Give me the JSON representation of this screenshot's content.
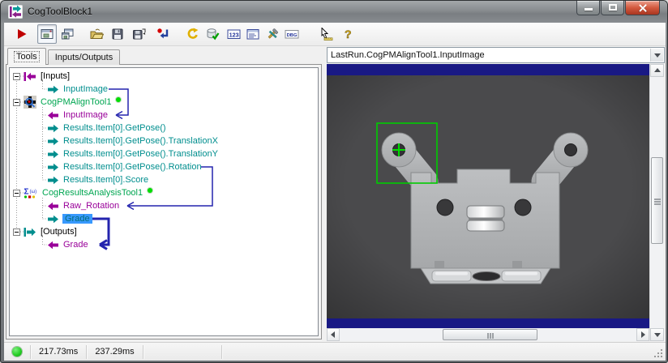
{
  "window": {
    "title": "CogToolBlock1"
  },
  "toolbar": {
    "numeric_label": "123",
    "debug_label": "DBG",
    "help_glyph": "?",
    "buttons": [
      {
        "name": "run",
        "icon": "run-icon"
      },
      {
        "name": "show-image-display",
        "icon": "image-display-icon",
        "pressed": true
      },
      {
        "name": "float-image-display",
        "icon": "float-window-icon"
      },
      {
        "name": "open",
        "icon": "open-folder-icon"
      },
      {
        "name": "save",
        "icon": "save-icon"
      },
      {
        "name": "save-as",
        "icon": "save-as-icon"
      },
      {
        "name": "reset",
        "icon": "reset-icon"
      },
      {
        "name": "rerun",
        "icon": "rerun-icon"
      },
      {
        "name": "validate",
        "icon": "database-check-icon"
      },
      {
        "name": "numeric-display",
        "icon": "numeric-123-icon"
      },
      {
        "name": "form",
        "icon": "form-icon"
      },
      {
        "name": "configure",
        "icon": "tools-icon"
      },
      {
        "name": "debug",
        "icon": "debug-icon"
      },
      {
        "name": "pointer-measure",
        "icon": "pointer-ruler-icon"
      },
      {
        "name": "help",
        "icon": "help-icon"
      }
    ]
  },
  "tabs": {
    "tools": "Tools",
    "inputs_outputs": "Inputs/Outputs"
  },
  "tree": {
    "items": [
      {
        "label": "[Inputs]",
        "kind": "block-inputs"
      },
      {
        "label": "InputImage",
        "kind": "output-terminal"
      },
      {
        "label": "CogPMAlignTool1",
        "kind": "tool",
        "status_dot": "green"
      },
      {
        "label": "InputImage",
        "kind": "input-terminal"
      },
      {
        "label": "Results.Item[0].GetPose()",
        "kind": "output-terminal"
      },
      {
        "label": "Results.Item[0].GetPose().TranslationX",
        "kind": "output-terminal"
      },
      {
        "label": "Results.Item[0].GetPose().TranslationY",
        "kind": "output-terminal"
      },
      {
        "label": "Results.Item[0].GetPose().Rotation",
        "kind": "output-terminal"
      },
      {
        "label": "Results.Item[0].Score",
        "kind": "output-terminal"
      },
      {
        "label": "CogResultsAnalysisTool1",
        "kind": "tool",
        "status_dot": "green"
      },
      {
        "label": "Raw_Rotation",
        "kind": "input-terminal"
      },
      {
        "label": "Grade",
        "kind": "output-terminal",
        "selected": true
      },
      {
        "label": "[Outputs]",
        "kind": "block-outputs"
      },
      {
        "label": "Grade",
        "kind": "input-terminal"
      }
    ]
  },
  "image_panel": {
    "selected_display": "LastRun.CogPMAlignTool1.InputImage"
  },
  "status_bar": {
    "tool_time": "217.73ms",
    "total_time": "237.29ms"
  },
  "colors": {
    "terminal_teal": "#008E8E",
    "terminal_purple": "#990099",
    "tool_green": "#00A651",
    "connector_navy": "#2424AE",
    "selection_blue": "#3899FE",
    "overlay_green": "#00CC00",
    "status_dot_green": "#22CC22",
    "image_band_navy": "#191984"
  }
}
